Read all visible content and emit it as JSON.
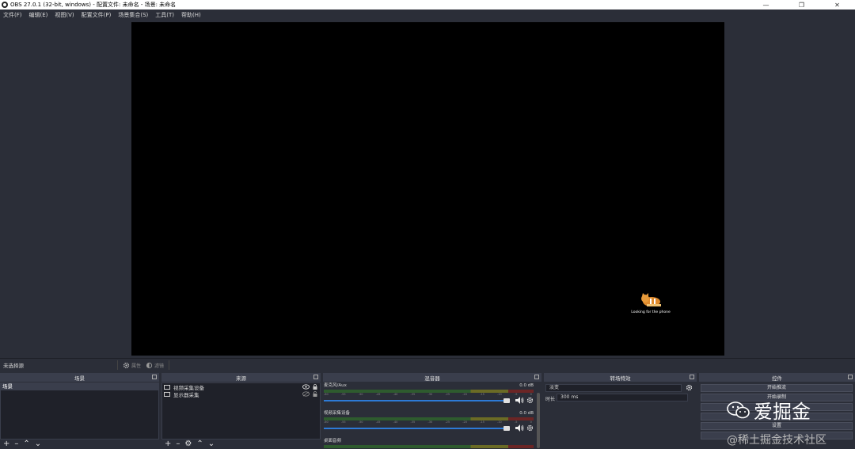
{
  "window": {
    "title": "OBS 27.0.1 (32-bit, windows) - 配置文件: 未命名 - 场景: 未命名"
  },
  "menu": [
    "文件(F)",
    "编辑(E)",
    "视图(V)",
    "配置文件(P)",
    "场景集合(S)",
    "工具(T)",
    "帮助(H)"
  ],
  "preview": {
    "loading_text": "Looking for the phone"
  },
  "context_bar": {
    "no_selection": "未选择源",
    "properties_label": "属性",
    "filters_label": "滤镜"
  },
  "docks": {
    "scenes": {
      "title": "场景",
      "items": [
        "场景"
      ]
    },
    "sources": {
      "title": "来源",
      "items": [
        "视频采集设备",
        "显示器采集"
      ]
    },
    "mixer": {
      "title": "混音器",
      "channels": [
        {
          "name": "麦克风/Aux",
          "level": "0.0 dB"
        },
        {
          "name": "视频采集设备",
          "level": "0.0 dB"
        },
        {
          "name": "桌面音频",
          "level": ""
        }
      ],
      "scale": [
        "-60",
        "-55",
        "-50",
        "-45",
        "-40",
        "-35",
        "-30",
        "-25",
        "-20",
        "-15",
        "-10",
        "-5",
        "0"
      ]
    },
    "transitions": {
      "title": "转场特效",
      "selected": "淡变",
      "duration_label": "时长",
      "duration_value": "300 ms"
    },
    "controls": {
      "title": "控件",
      "buttons": [
        "开始推流",
        "开始录制",
        "",
        "",
        "设置",
        ""
      ]
    }
  },
  "watermark": {
    "brand": "爱掘金",
    "sub": "@稀土掘金技术社区"
  }
}
